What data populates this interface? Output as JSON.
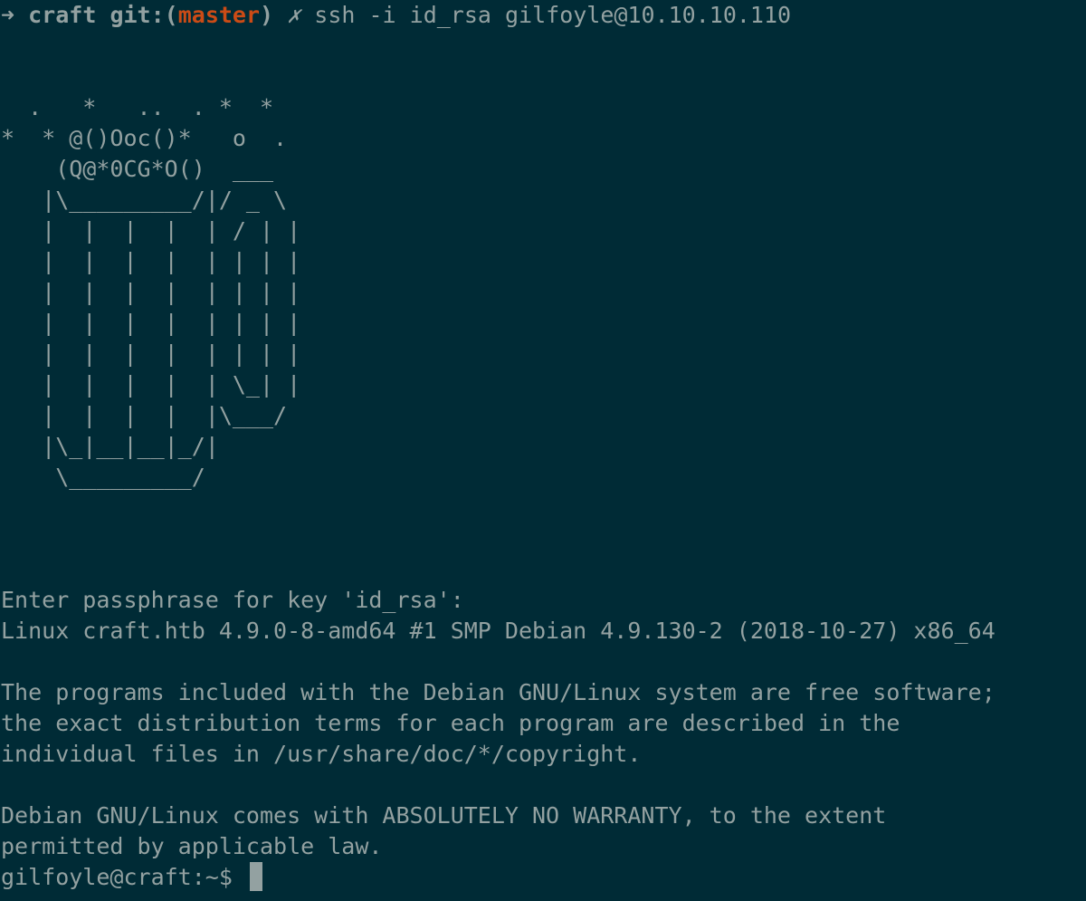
{
  "prompt": {
    "arrow": "➜",
    "dir": "craft",
    "git_prefix": "git:(",
    "branch": "master",
    "git_suffix": ")",
    "dirty": "✗",
    "command": "ssh -i id_rsa gilfoyle@10.10.10.110"
  },
  "banner_art": "  .   *   ..  . *  *\n*  * @()Ooc()*   o  .\n    (Q@*0CG*O()  ___\n   |\\_________/|/ _ \\\n   |  |  |  |  | / | |\n   |  |  |  |  | | | |\n   |  |  |  |  | | | |\n   |  |  |  |  | | | |\n   |  |  |  |  | | | |\n   |  |  |  |  | \\_| |\n   |  |  |  |  |\\___/\n   |\\_|__|__|_/|\n    \\_________/",
  "output": {
    "passphrase": "Enter passphrase for key 'id_rsa':",
    "uname": "Linux craft.htb 4.9.0-8-amd64 #1 SMP Debian 4.9.130-2 (2018-10-27) x86_64",
    "motd_1": "The programs included with the Debian GNU/Linux system are free software;",
    "motd_2": "the exact distribution terms for each program are described in the",
    "motd_3": "individual files in /usr/share/doc/*/copyright.",
    "warranty_1": "Debian GNU/Linux comes with ABSOLUTELY NO WARRANTY, to the extent",
    "warranty_2": "permitted by applicable law.",
    "shell_prompt": "gilfoyle@craft:~$ "
  },
  "colors": {
    "background": "#002b36",
    "foreground": "#93a1a1",
    "branch": "#cb4b16"
  }
}
